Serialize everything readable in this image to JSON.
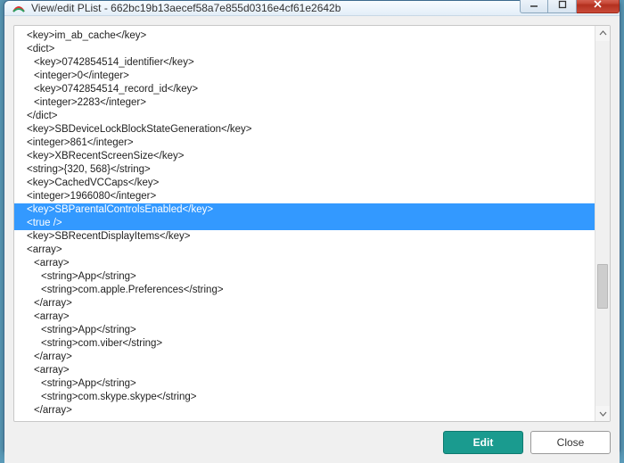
{
  "window": {
    "title": "View/edit PList - 662bc19b13aecef58a7e855d0316e4cf61e2642b"
  },
  "buttons": {
    "edit": "Edit",
    "close": "Close"
  },
  "plist_lines": [
    {
      "text": "<key>im_ab_cache</key>",
      "indent": 1,
      "selected": false
    },
    {
      "text": "<dict>",
      "indent": 1,
      "selected": false
    },
    {
      "text": "<key>0742854514_identifier</key>",
      "indent": 2,
      "selected": false
    },
    {
      "text": "<integer>0</integer>",
      "indent": 2,
      "selected": false
    },
    {
      "text": "<key>0742854514_record_id</key>",
      "indent": 2,
      "selected": false
    },
    {
      "text": "<integer>2283</integer>",
      "indent": 2,
      "selected": false
    },
    {
      "text": "</dict>",
      "indent": 1,
      "selected": false
    },
    {
      "text": "<key>SBDeviceLockBlockStateGeneration</key>",
      "indent": 1,
      "selected": false
    },
    {
      "text": "<integer>861</integer>",
      "indent": 1,
      "selected": false
    },
    {
      "text": "<key>XBRecentScreenSize</key>",
      "indent": 1,
      "selected": false
    },
    {
      "text": "<string>{320, 568}</string>",
      "indent": 1,
      "selected": false
    },
    {
      "text": "<key>CachedVCCaps</key>",
      "indent": 1,
      "selected": false
    },
    {
      "text": "<integer>1966080</integer>",
      "indent": 1,
      "selected": false
    },
    {
      "text": "<key>SBParentalControlsEnabled</key>",
      "indent": 1,
      "selected": true
    },
    {
      "text": "<true />",
      "indent": 1,
      "selected": true
    },
    {
      "text": "<key>SBRecentDisplayItems</key>",
      "indent": 1,
      "selected": false
    },
    {
      "text": "<array>",
      "indent": 1,
      "selected": false
    },
    {
      "text": "<array>",
      "indent": 2,
      "selected": false
    },
    {
      "text": "<string>App</string>",
      "indent": 3,
      "selected": false
    },
    {
      "text": "<string>com.apple.Preferences</string>",
      "indent": 3,
      "selected": false
    },
    {
      "text": "</array>",
      "indent": 2,
      "selected": false
    },
    {
      "text": "<array>",
      "indent": 2,
      "selected": false
    },
    {
      "text": "<string>App</string>",
      "indent": 3,
      "selected": false
    },
    {
      "text": "<string>com.viber</string>",
      "indent": 3,
      "selected": false
    },
    {
      "text": "</array>",
      "indent": 2,
      "selected": false
    },
    {
      "text": "<array>",
      "indent": 2,
      "selected": false
    },
    {
      "text": "<string>App</string>",
      "indent": 3,
      "selected": false
    },
    {
      "text": "<string>com.skype.skype</string>",
      "indent": 3,
      "selected": false
    },
    {
      "text": "</array>",
      "indent": 2,
      "selected": false
    }
  ]
}
